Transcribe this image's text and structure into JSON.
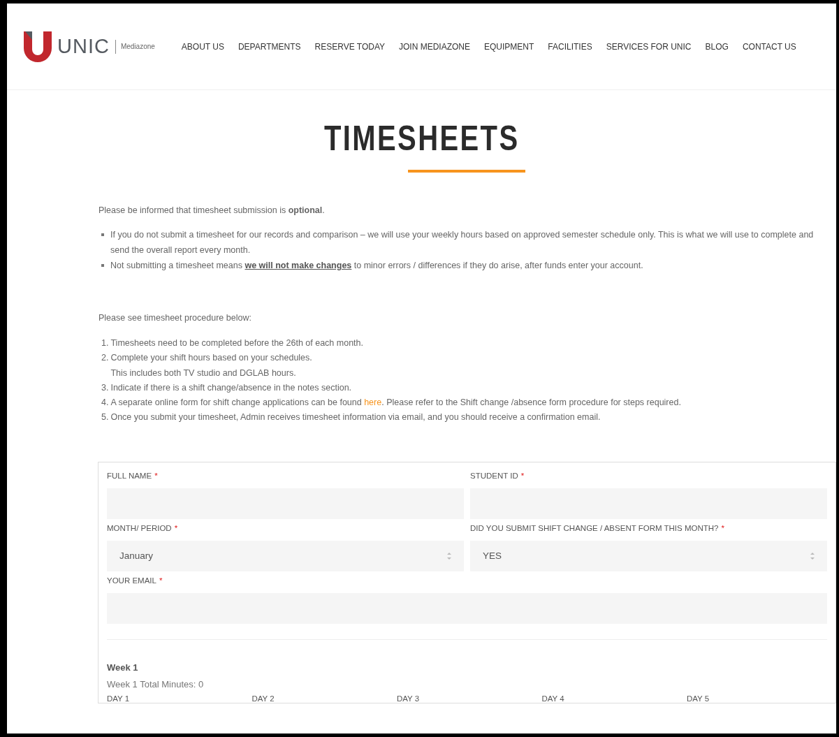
{
  "header": {
    "logo": {
      "brand": "UNIC",
      "sub": "Mediazone"
    },
    "nav": [
      {
        "label": "ABOUT US"
      },
      {
        "label": "DEPARTMENTS"
      },
      {
        "label": "RESERVE TODAY"
      },
      {
        "label": "JOIN MEDIAZONE"
      },
      {
        "label": "EQUIPMENT"
      },
      {
        "label": "FACILITIES"
      },
      {
        "label": "SERVICES FOR UNIC"
      },
      {
        "label": "BLOG"
      },
      {
        "label": "CONTACT US"
      }
    ]
  },
  "page_title": "TIMESHEETS",
  "intro": {
    "text": "Please be informed that timesheet submission is **optional**.",
    "bullets": [
      {
        "before": "If you do not submit a timesheet for our records and comparison – we will use your weekly hours based on approved semester schedule only. This is what we will use to complete and send the overall report every month."
      },
      {
        "before": "Not submitting a timesheet means ",
        "link": "we will not make changes",
        "after": " to minor errors / differences if they do arise, after funds enter your account."
      }
    ]
  },
  "procedure": {
    "text": "Please see timesheet procedure below:",
    "steps": [
      {
        "number": "1.",
        "before": "Timesheets need to be completed before the 26th of each month."
      },
      {
        "number": "2.",
        "before": "Complete your shift hours based on your schedules.",
        "note": "This includes both TV studio and DGLAB hours."
      },
      {
        "number": "3.",
        "before": "Indicate if there is a shift change/absence in the notes section."
      },
      {
        "number": "4.",
        "before": " A separate online form for shift change applications can be found ",
        "link": "here",
        "after": ".  Please refer to the Shift change /absence form procedure for steps required."
      },
      {
        "number": "5.",
        "before": "Once you submit your timesheet, Admin receives timesheet information via email, and you should receive a confirmation email."
      }
    ]
  },
  "form": {
    "required_mark": "*",
    "rows": [
      [
        {
          "label": "FULL NAME",
          "required": true,
          "kind": "text"
        },
        {
          "label": "STUDENT ID",
          "required": true,
          "kind": "text"
        }
      ],
      [
        {
          "label": "MONTH/ PERIOD",
          "required": true,
          "kind": "select",
          "value": "January"
        },
        {
          "label": "DID YOU SUBMIT SHIFT CHANGE / ABSENT FORM THIS MONTH?",
          "required": true,
          "kind": "select",
          "value": "YES"
        }
      ],
      [
        {
          "label": "YOUR EMAIL",
          "required": true,
          "kind": "text"
        }
      ]
    ],
    "week": {
      "title": "Week 1",
      "total": "Week 1 Total Minutes: 0",
      "days": [
        "DAY 1",
        "DAY 2",
        "DAY 3",
        "DAY 4",
        "DAY 5"
      ]
    }
  }
}
